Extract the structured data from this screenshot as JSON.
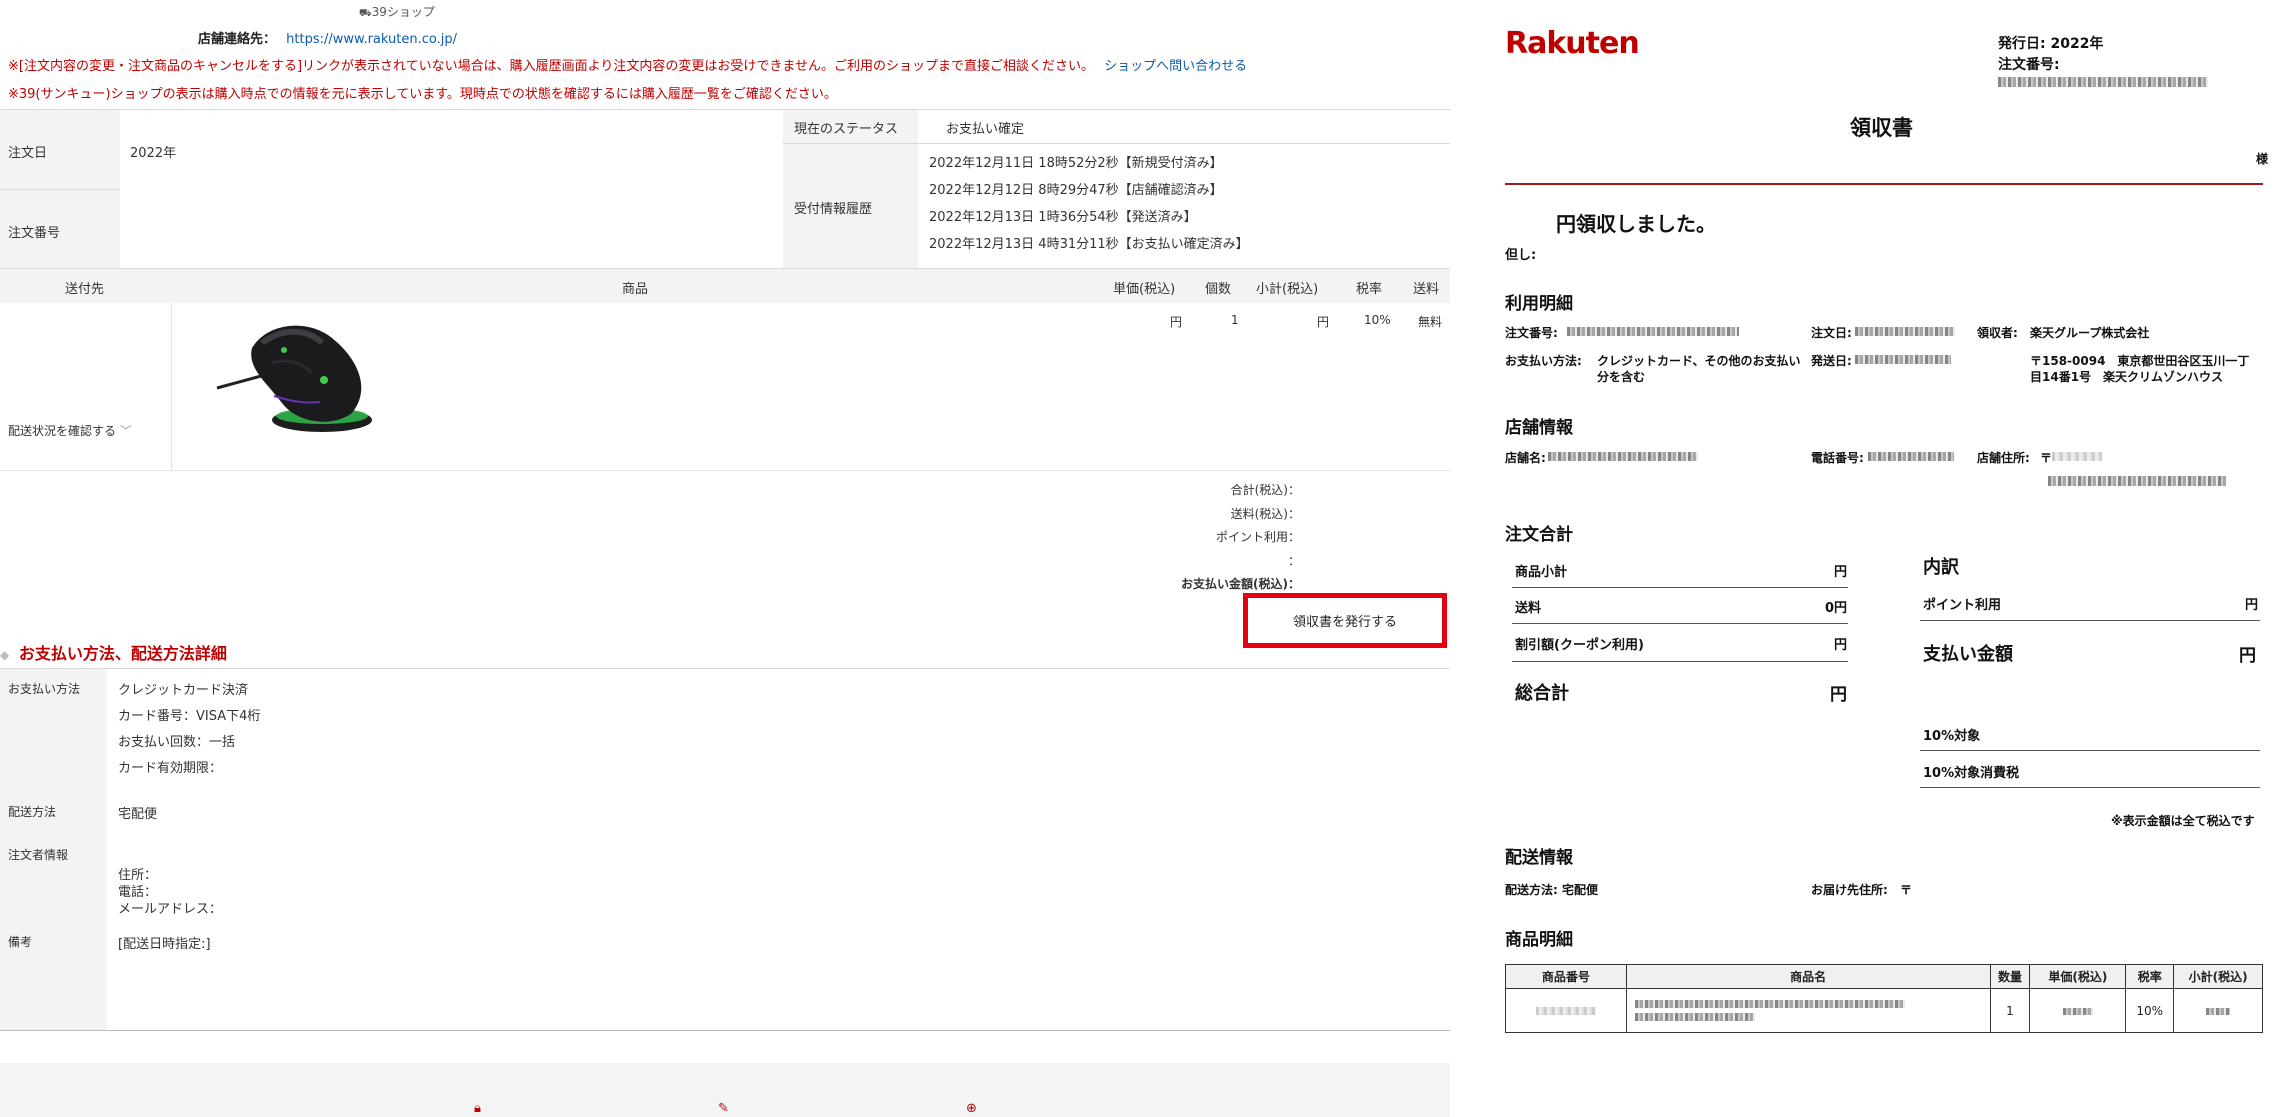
{
  "left": {
    "shop_badge": "39ショップ",
    "contact_label": "店舗連絡先：",
    "contact_url": "https://www.rakuten.co.jp/",
    "notice1": "※[注文内容の変更・注文商品のキャンセルをする]リンクが表示されていない場合は、購入履歴画面より注文内容の変更はお受けできません。ご利用のショップまで直接ご相談ください。",
    "notice1_link": "ショップへ問い合わせる",
    "notice2": "※39(サンキュー)ショップの表示は購入時点での情報を元に表示しています。現時点での状態を確認するには購入履歴一覧をご確認ください。",
    "order_date_label": "注文日",
    "order_date_value": "2022年",
    "order_number_label": "注文番号",
    "status_label": "現在のステータス",
    "status_value": "お支払い確定",
    "history_label": "受付情報履歴",
    "history": [
      "2022年12月11日 18時52分2秒【新規受付済み】",
      "2022年12月12日 8時29分47秒【店舗確認済み】",
      "2022年12月13日 1時36分54秒【発送済み】",
      "2022年12月13日 4時31分11秒【お支払い確定済み】"
    ],
    "table_headers": {
      "dest": "送付先",
      "product": "商品",
      "unit_price": "単価(税込)",
      "qty": "個数",
      "subtotal": "小計(税込)",
      "tax": "税率",
      "shipping": "送料"
    },
    "row": {
      "unit_price": "円",
      "qty": "1",
      "subtotal": "円",
      "tax": "10%",
      "shipping": "無料"
    },
    "delivery_check": "配送状況を確認する",
    "totals": {
      "total": "合計(税込)：",
      "shipping": "送料(税込)：",
      "points": "ポイント利用：",
      "blank": "：",
      "payment": "お支払い金額(税込)："
    },
    "receipt_button": "領収書を発行する",
    "payment_section_title": "お支払い方法、配送方法詳細",
    "payment_method_label": "お支払い方法",
    "payment_lines": [
      "クレジットカード決済",
      "カード番号：VISA下4桁",
      "お支払い回数：一括",
      "カード有効期限："
    ],
    "delivery_method_label": "配送方法",
    "delivery_method_value": "宅配便",
    "orderer_label": "注文者情報",
    "orderer_lines": [
      "住所：",
      "電話：",
      "メールアドレス："
    ],
    "remarks_label": "備考",
    "remarks_value": "[配送日時指定:]"
  },
  "receipt": {
    "logo": "Rakuten",
    "issue_date": "発行日: 2022年",
    "order_no_label": "注文番号:",
    "title": "領収書",
    "sama": "様",
    "received": "円領収しました。",
    "tadashi": "但し:",
    "usage_title": "利用明細",
    "usage": {
      "order_no": "注文番号:",
      "order_date": "注文日:",
      "receiver_label": "領収者:",
      "receiver_value": "楽天グループ株式会社",
      "pay_label": "お支払い方法:",
      "pay_value_1": "クレジットカード、その他のお支払い",
      "pay_value_2": "分を含む",
      "ship_date": "発送日:",
      "address_1": "〒158-0094　東京都世田谷区玉川一丁",
      "address_2": "目14番1号　楽天クリムゾンハウス"
    },
    "shop_title": "店舗情報",
    "shop": {
      "name_label": "店舗名:",
      "tel_label": "電話番号:",
      "addr_label": "店舗住所:",
      "addr_zip": "〒"
    },
    "order_total_title": "注文合計",
    "order_total": {
      "subtotal_label": "商品小計",
      "subtotal_value": "円",
      "shipping_label": "送料",
      "shipping_value": "0円",
      "discount_label": "割引額(クーポン利用)",
      "discount_value": "円",
      "grand_label": "総合計",
      "grand_value": "円"
    },
    "breakdown": {
      "title": "内訳",
      "points_label": "ポイント利用",
      "points_value": "円",
      "pay_label": "支払い金額",
      "pay_value": "円",
      "tax10_label": "10%対象",
      "tax10_cons_label": "10%対象消費税"
    },
    "tax_note": "※表示金額は全て税込です",
    "delivery_title": "配送情報",
    "delivery": {
      "method": "配送方法: 宅配便",
      "dest_label": "お届け先住所:",
      "dest_zip": "〒"
    },
    "items_title": "商品明細",
    "items_headers": [
      "商品番号",
      "商品名",
      "数量",
      "単価(税込)",
      "税率",
      "小計(税込)"
    ],
    "items_row": {
      "qty": "1",
      "tax": "10%"
    }
  }
}
